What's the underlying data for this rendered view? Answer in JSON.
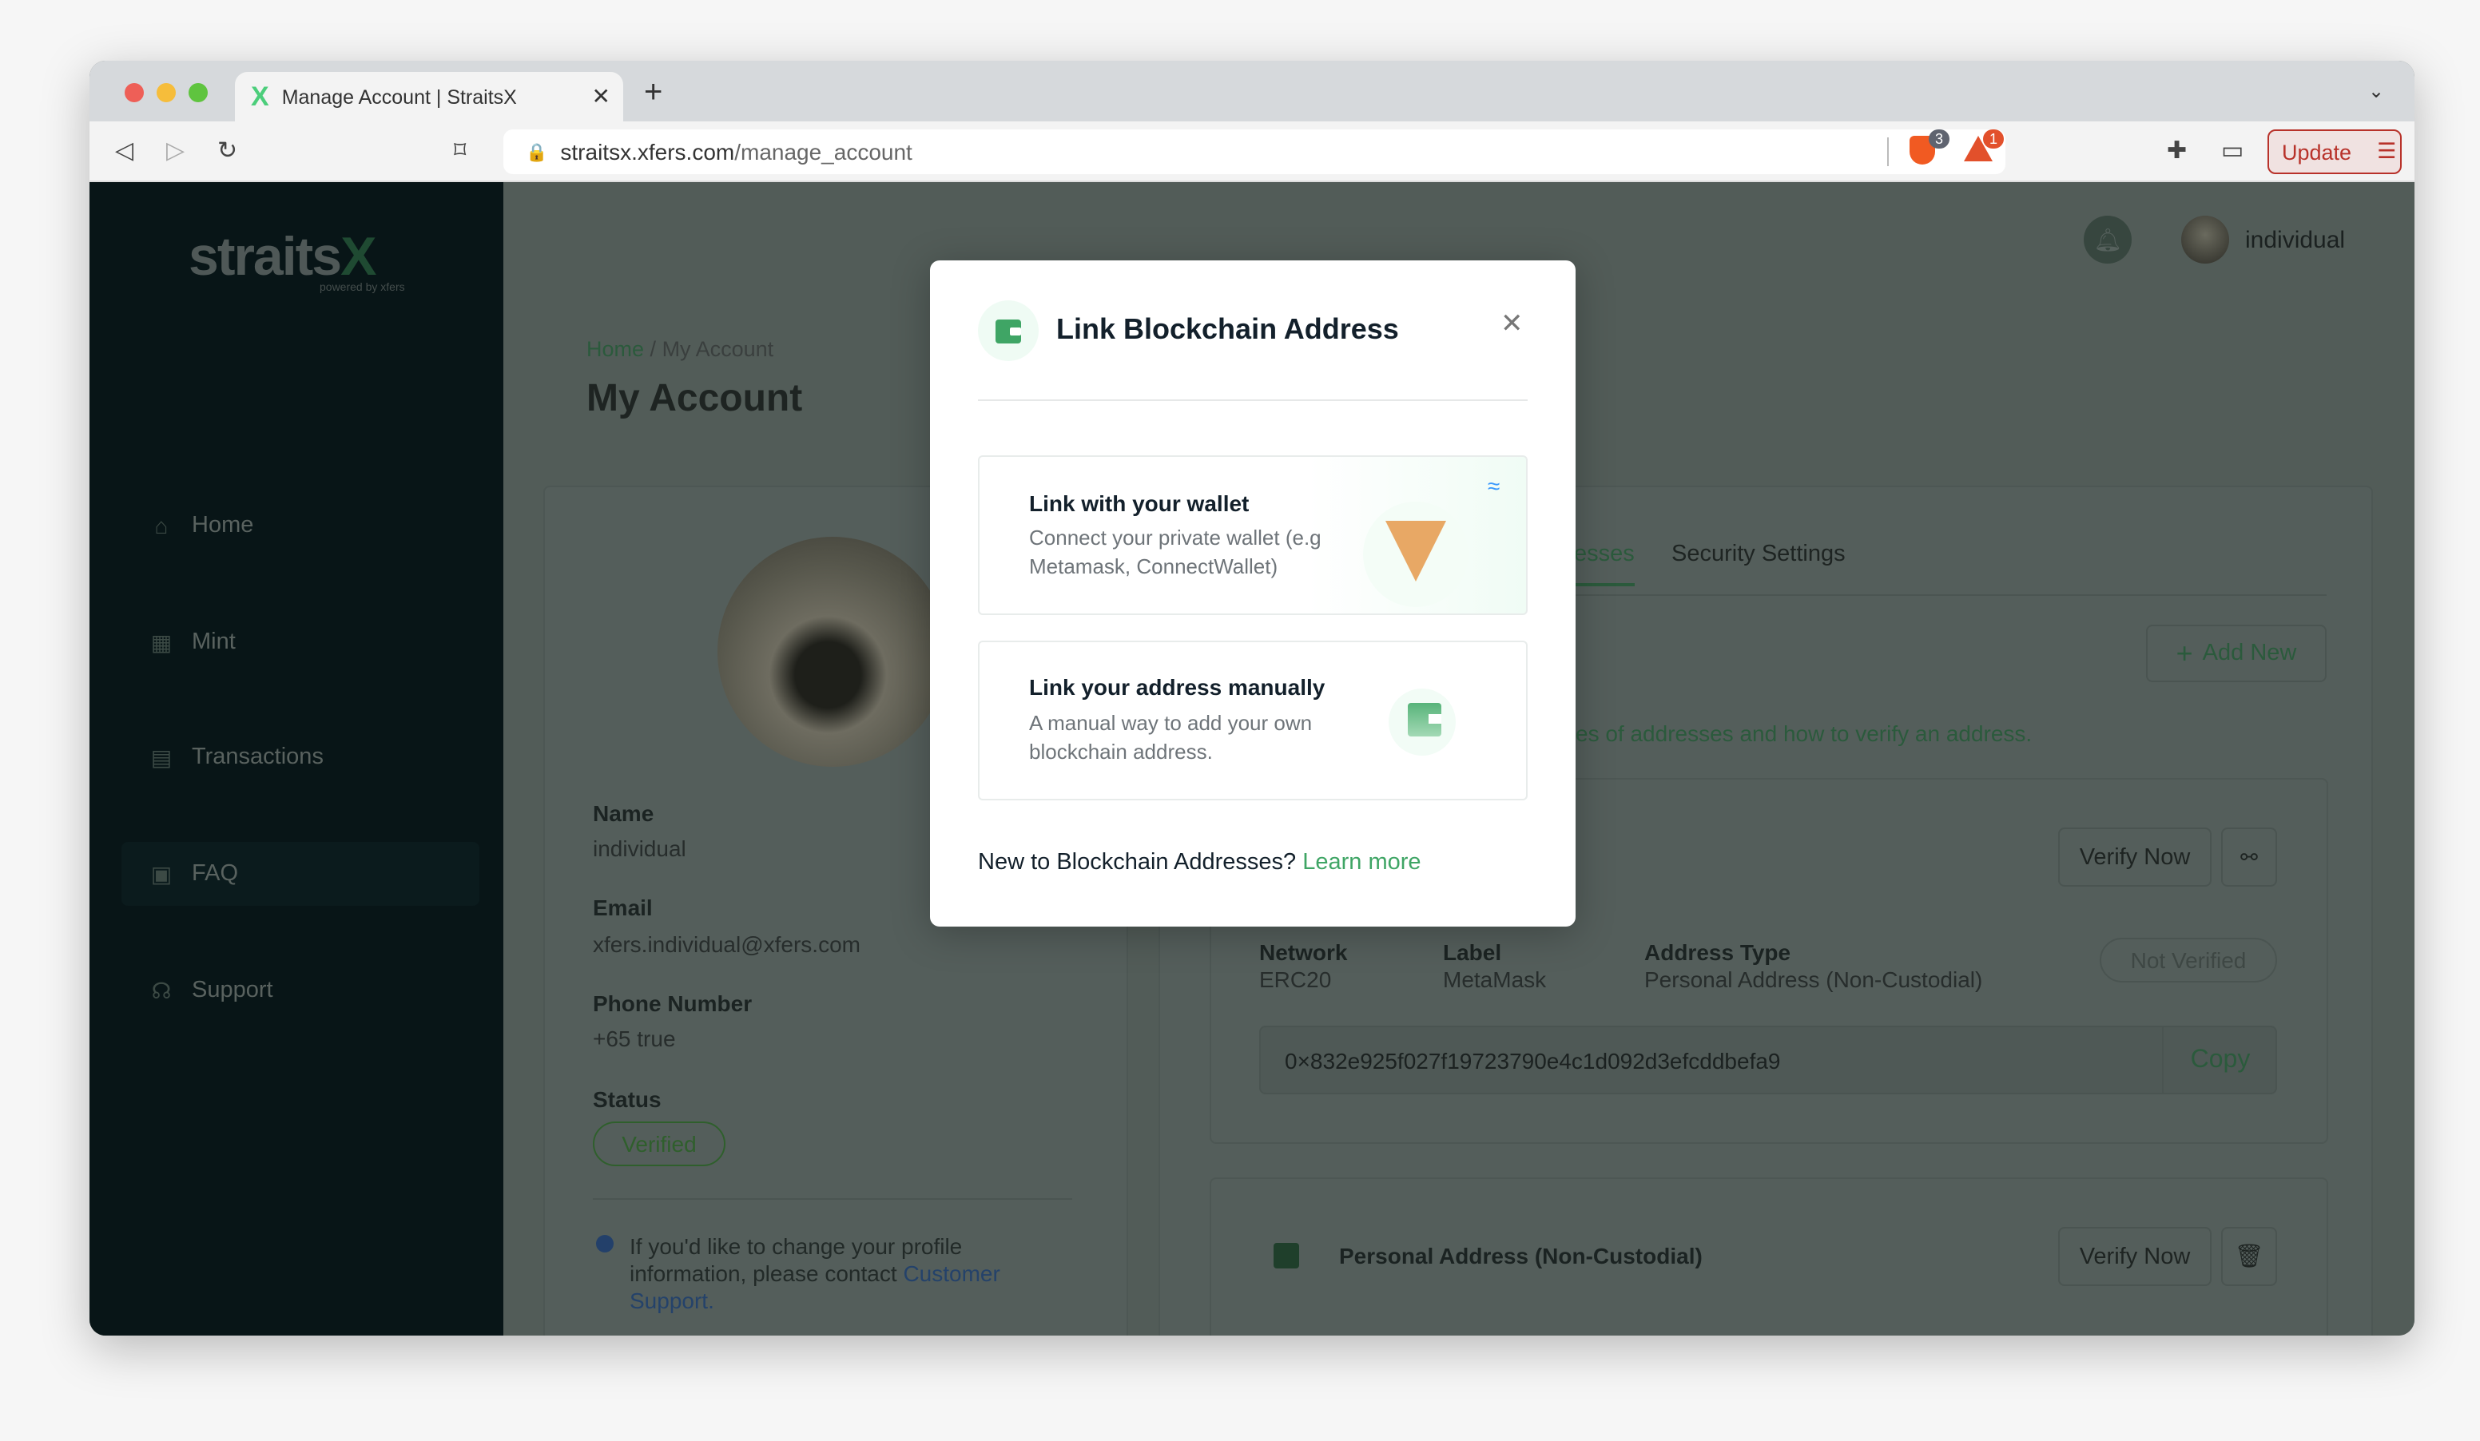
{
  "browser": {
    "tab_title": "Manage Account | StraitsX",
    "url_host": "straitsx.xfers.com",
    "url_path": "/manage_account",
    "brave_badge": "3",
    "bat_badge": "1",
    "update_label": "Update"
  },
  "sidebar": {
    "logo": "straits",
    "logo_x": "X",
    "powered": "powered by xfers",
    "items": [
      {
        "label": "Home",
        "icon": "home-icon"
      },
      {
        "label": "Mint",
        "icon": "mint-icon"
      },
      {
        "label": "Transactions",
        "icon": "transactions-icon"
      },
      {
        "label": "FAQ",
        "icon": "faq-icon"
      },
      {
        "label": "Support",
        "icon": "headset-icon"
      }
    ]
  },
  "header": {
    "username": "individual"
  },
  "breadcrumb": {
    "home": "Home",
    "sep": " / ",
    "current": "My Account"
  },
  "page_title": "My Account",
  "profile": {
    "name_label": "Name",
    "name": "individual",
    "email_label": "Email",
    "email": "xfers.individual@xfers.com",
    "phone_label": "Phone Number",
    "phone": "+65 true",
    "status_label": "Status",
    "status": "Verified",
    "info_text": "If you'd like to change your profile information, please contact ",
    "info_link": "Customer Support."
  },
  "tabs": {
    "addresses_partial": "esses",
    "security": "Security Settings"
  },
  "addresses": {
    "add_new": "Add New",
    "help_partial": "es of addresses and how to ",
    "help_link": "verify an address.",
    "items": [
      {
        "verify": "Verify Now",
        "network_label": "Network",
        "network": "ERC20",
        "label_label": "Label",
        "label": "MetaMask",
        "type_label": "Address Type",
        "type": "Personal Address (Non-Custodial)",
        "status": "Not Verified",
        "address": "0×832e925f027f19723790e4c1d092d3efcddbefa9",
        "copy": "Copy"
      },
      {
        "title": "Personal Address (Non-Custodial)",
        "verify": "Verify Now"
      }
    ]
  },
  "modal": {
    "title": "Link Blockchain Address",
    "option1_title": "Link with your wallet",
    "option1_desc": "Connect your private wallet (e.g Metamask, ConnectWallet)",
    "option2_title": "Link your address manually",
    "option2_desc": "A manual way to add your own blockchain address.",
    "footer": "New to Blockchain Addresses? ",
    "footer_link": "Learn more"
  },
  "colors": {
    "accent": "#3fa565",
    "sidebar": "#081517",
    "update": "#b8322a"
  }
}
